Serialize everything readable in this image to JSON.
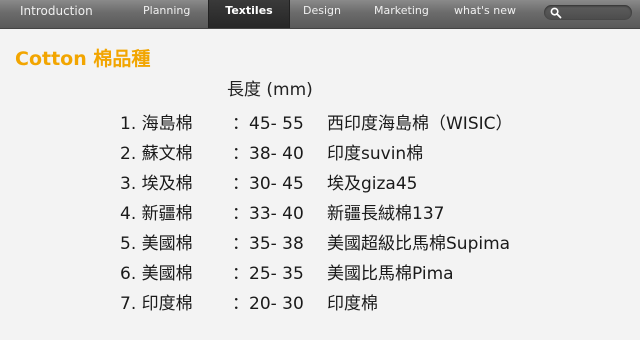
{
  "nav": {
    "items": [
      {
        "label": "Introduction",
        "active": false
      },
      {
        "label": "Planning",
        "active": false
      },
      {
        "label": "Textiles",
        "active": true
      },
      {
        "label": "Design",
        "active": false
      },
      {
        "label": "Marketing",
        "active": false
      },
      {
        "label": "what's new",
        "active": false
      }
    ],
    "search_icon": "search-icon"
  },
  "content": {
    "title_latin": "Cotton",
    "title_cjk": "棉品種",
    "column_header": "長度 (mm)",
    "rows": [
      {
        "name": "1. 海島棉",
        "length": "：45- 55",
        "variety": "西印度海島棉（WISIC）"
      },
      {
        "name": "2. 蘇文棉",
        "length": "：38- 40",
        "variety": "印度suvin棉"
      },
      {
        "name": "3. 埃及棉",
        "length": "：30- 45",
        "variety": "埃及giza45"
      },
      {
        "name": "4. 新疆棉",
        "length": "：33- 40",
        "variety": "新疆長絨棉137"
      },
      {
        "name": "5. 美國棉",
        "length": "：35- 38",
        "variety": "美國超級比馬棉Supima"
      },
      {
        "name": "6. 美國棉",
        "length": "：25- 35",
        "variety": "美國比馬棉Pima"
      },
      {
        "name": "7. 印度棉",
        "length": "：20- 30",
        "variety": "印度棉"
      }
    ]
  },
  "colors": {
    "title": "#f2a500",
    "nav_bg": "#6b6b6b",
    "nav_active_bg": "#2c2c2c",
    "page_bg": "#f3f3f3"
  }
}
